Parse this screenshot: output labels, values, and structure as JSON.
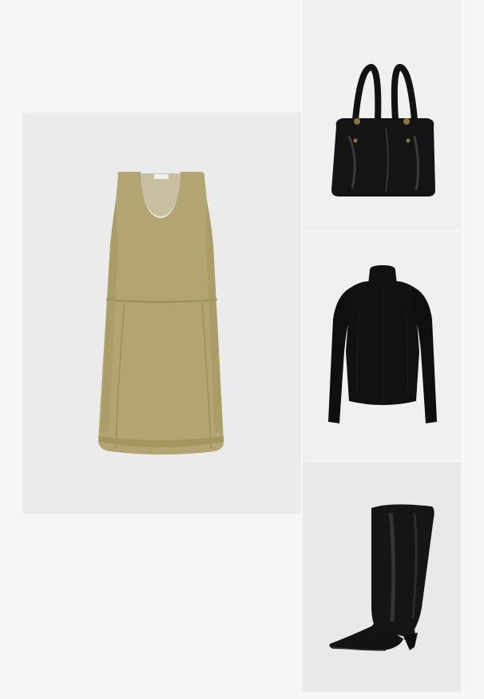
{
  "outfit": {
    "items": [
      {
        "id": "dress",
        "icon": "pinafore-dress-icon",
        "color": "#b3a572"
      },
      {
        "id": "bag",
        "icon": "handbag-icon",
        "color": "#141414"
      },
      {
        "id": "top",
        "icon": "turtleneck-top-icon",
        "color": "#111111"
      },
      {
        "id": "boot",
        "icon": "knee-high-boot-icon",
        "color": "#151515"
      }
    ]
  }
}
